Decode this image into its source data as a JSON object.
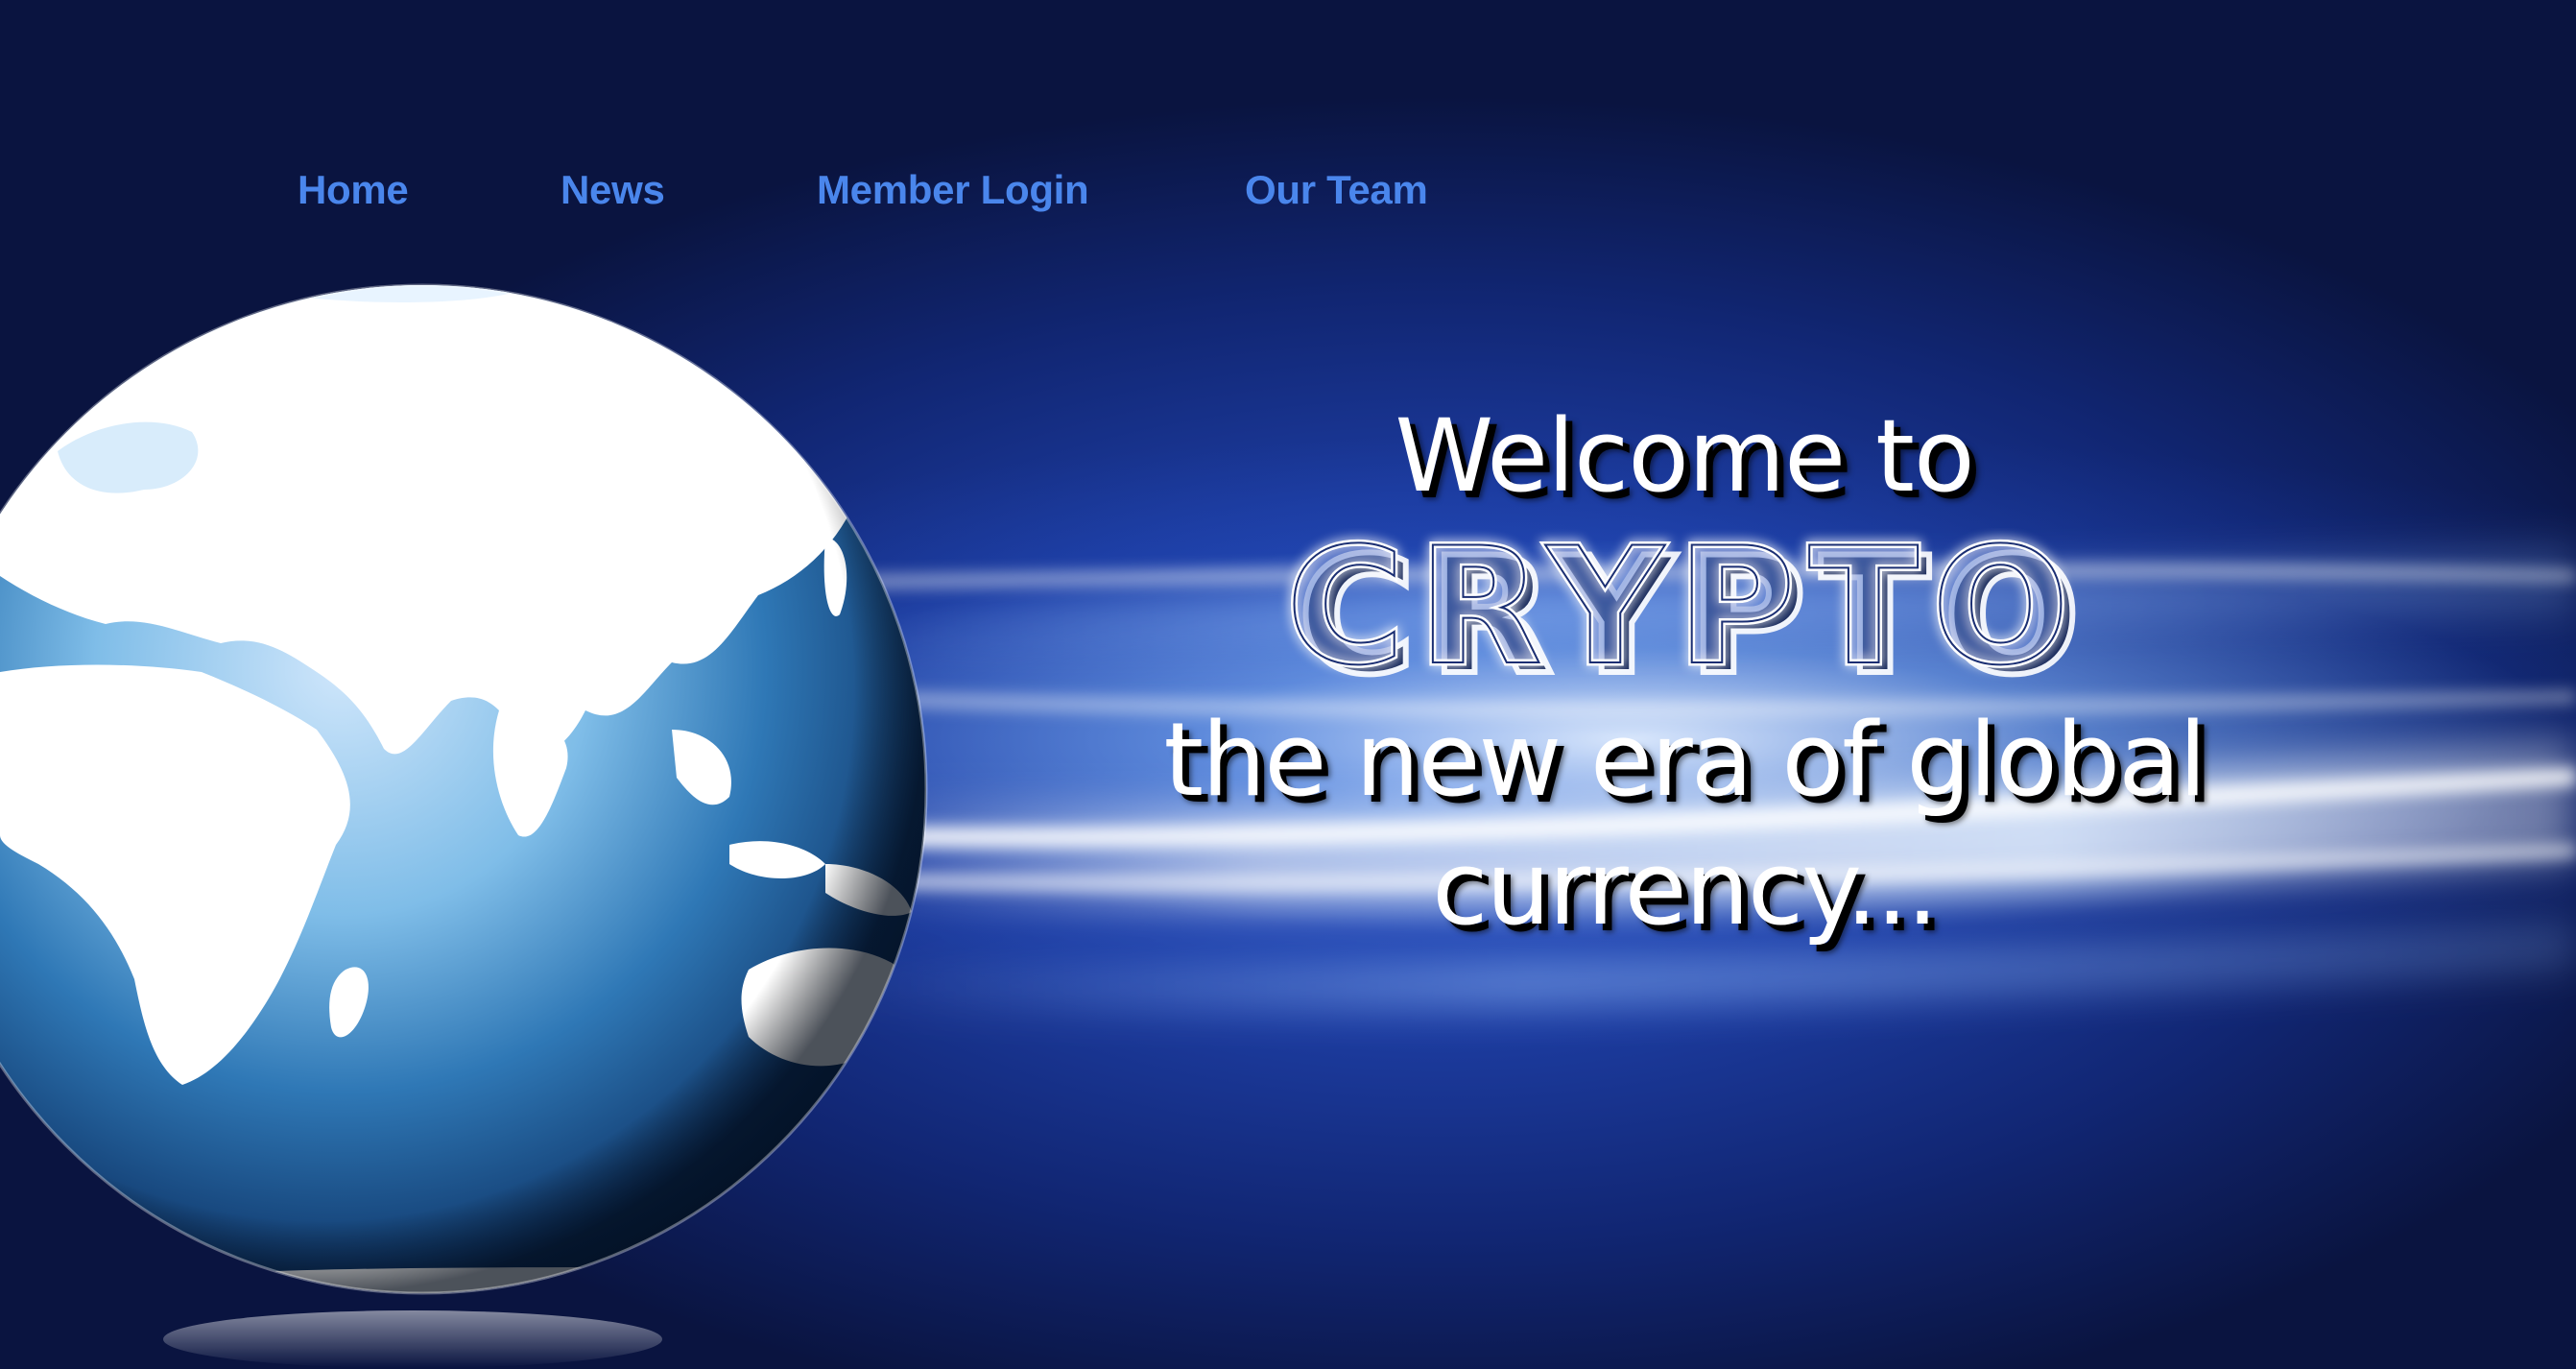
{
  "nav": {
    "items": [
      {
        "label": "Home"
      },
      {
        "label": "News"
      },
      {
        "label": "Member Login"
      },
      {
        "label": "Our Team"
      }
    ]
  },
  "hero": {
    "welcome": "Welcome to",
    "brand": "CRYPTO",
    "tagline": "the new era of global currency..."
  },
  "colors": {
    "nav_link": "#4a86ec",
    "background_top": "#030618",
    "background_mid": "#112a86",
    "hero_text": "#ffffff",
    "text_shadow": "#000000"
  },
  "icons": [
    "globe-icon"
  ]
}
